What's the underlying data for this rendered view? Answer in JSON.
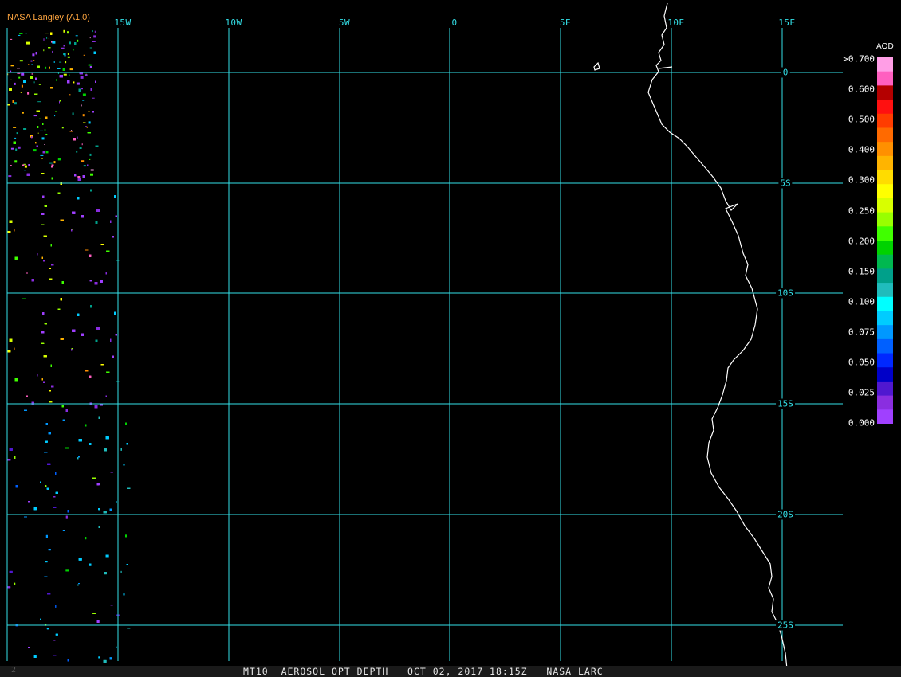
{
  "credit": "NASA Langley (A1.0)",
  "footer": {
    "product": "MT10",
    "parameter": "AEROSOL OPT DEPTH",
    "datetime": "OCT 02, 2017 18:15Z",
    "agency": "NASA LARC",
    "frame": "2"
  },
  "map": {
    "longitude_labels": [
      "15W",
      "10W",
      "5W",
      "0",
      "5E",
      "10E",
      "15E"
    ],
    "latitude_labels": [
      "0",
      "5S",
      "10S",
      "15S",
      "20S",
      "25S"
    ],
    "grid_color": "#33e0e8",
    "coast_color": "#ffffff",
    "credit_color": "#ffa640"
  },
  "legend": {
    "title": "AOD",
    "ticks": [
      ">0.700",
      "0.600",
      "0.500",
      "0.400",
      "0.300",
      "0.250",
      "0.200",
      "0.150",
      "0.100",
      "0.075",
      "0.050",
      "0.025",
      "0.000"
    ],
    "colors": [
      "#ff9ee6",
      "#ff5fc0",
      "#b40000",
      "#ff1010",
      "#ff3c00",
      "#ff6a00",
      "#ff9000",
      "#ffb400",
      "#ffdc00",
      "#ffff00",
      "#d8ff00",
      "#98ff00",
      "#40ff00",
      "#00d200",
      "#00b850",
      "#00a08a",
      "#20bcbc",
      "#00ffff",
      "#00ccff",
      "#0098ff",
      "#0060ff",
      "#0028ff",
      "#0000c8",
      "#5018d0",
      "#8a2ee0",
      "#a040ff"
    ]
  }
}
